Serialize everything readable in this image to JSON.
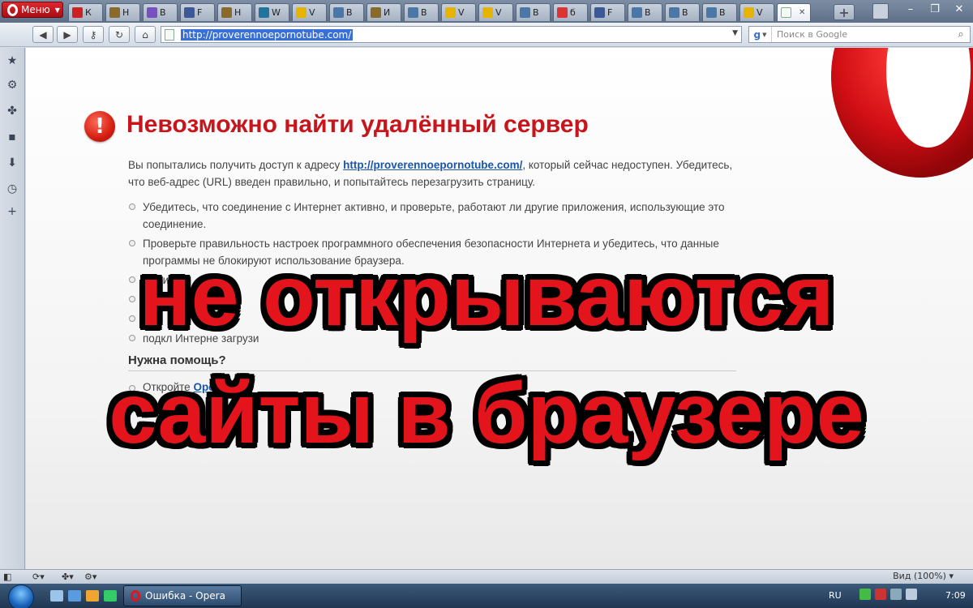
{
  "browser": {
    "menu_label": "Меню",
    "tabs": [
      {
        "label": "К",
        "icon": "tab-favicon-red-icon"
      },
      {
        "label": "Н",
        "icon": "tab-favicon-shield-icon"
      },
      {
        "label": "В",
        "icon": "tab-favicon-purple-icon"
      },
      {
        "label": "F",
        "icon": "facebook-icon"
      },
      {
        "label": "Н",
        "icon": "tab-favicon-shield-icon"
      },
      {
        "label": "W",
        "icon": "wordpress-icon"
      },
      {
        "label": "V",
        "icon": "tab-favicon-multicolor-icon"
      },
      {
        "label": "В",
        "icon": "vk-icon"
      },
      {
        "label": "И",
        "icon": "tab-favicon-shield-icon"
      },
      {
        "label": "В",
        "icon": "vk-icon"
      },
      {
        "label": "V",
        "icon": "tab-favicon-multicolor-icon"
      },
      {
        "label": "V",
        "icon": "tab-favicon-multicolor-icon"
      },
      {
        "label": "В",
        "icon": "vk-icon"
      },
      {
        "label": "б",
        "icon": "yandex-icon"
      },
      {
        "label": "F",
        "icon": "facebook-icon"
      },
      {
        "label": "В",
        "icon": "vk-icon"
      },
      {
        "label": "В",
        "icon": "vk-icon"
      },
      {
        "label": "В",
        "icon": "vk-icon"
      },
      {
        "label": "V",
        "icon": "tab-favicon-multicolor-icon"
      }
    ],
    "new_tab_label": "+",
    "url": "http://proverennoepornotube.com/",
    "search_placeholder": "Поиск в Google",
    "zoom_label": "Вид (100%)"
  },
  "page": {
    "title": "Невозможно найти удалённый сервер",
    "intro_before": "Вы попытались получить доступ к адресу ",
    "intro_link": "http://proverennoepornotube.com/",
    "intro_after": ", который сейчас недоступен. Убедитесь, что веб-адрес (URL) введен правильно, и попытайтесь перезагрузить страницу.",
    "bullets": [
      "Убедитесь, что соединение с Интернет активно, и проверьте, работают ли другие приложения, использующие это соединение.",
      "Проверьте правильность настроек программного обеспечения безопасности Интернета и убедитесь, что данные программы не блокируют использование браузера.",
      "защи",
      "лем",
      "F1",
      "подкл Интерне загрузи"
    ],
    "help_title": "Нужна помощь?",
    "help_items": [
      {
        "before": "Откройте ",
        "link": "Opera"
      },
      {
        "before": "",
        "link": "Opera Инте"
      }
    ]
  },
  "overlay": {
    "line1": "не открываются",
    "line2": "сайты в браузере"
  },
  "taskbar": {
    "task_label": "Ошибка - Opera",
    "language": "RU",
    "clock": "7:09"
  },
  "colors": {
    "accent_red": "#e3141b",
    "title_red": "#c8151b",
    "link_blue": "#1a55a8"
  }
}
